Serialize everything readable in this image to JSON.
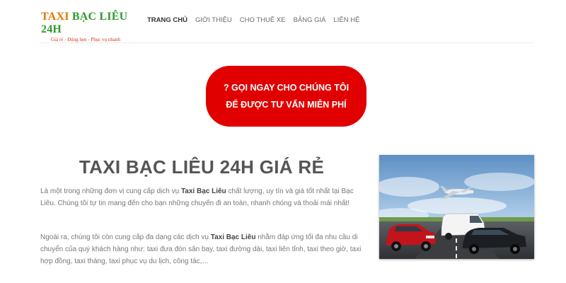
{
  "logo": {
    "title_part1": "TAXI ",
    "title_part2": "BẠC LIÊU 24H",
    "tagline": "Giá rẻ - Đúng hẹn - Phục vụ nhanh"
  },
  "nav": {
    "items": [
      {
        "label": "TRANG CHỦ",
        "active": true
      },
      {
        "label": "GIỚI THIỆU",
        "active": false
      },
      {
        "label": "CHO THUÊ XE",
        "active": false
      },
      {
        "label": "BẢNG GIÁ",
        "active": false
      },
      {
        "label": "LIÊN HỆ",
        "active": false
      }
    ]
  },
  "cta": {
    "line1": "? GỌI NGAY CHO CHÚNG TÔI",
    "line2": "ĐỂ ĐƯỢC TƯ VẤN MIỄN PHÍ"
  },
  "main": {
    "title": "TAXI BẠC LIÊU 24H GIÁ RẺ",
    "p1_pre": "Là một trong những đơn vị cung cấp dịch vụ ",
    "p1_bold": "Taxi Bạc Liêu",
    "p1_post": " chất lượng, uy tín và giá tốt nhất tại Bạc Liêu. Chúng tôi tự tin mang đến cho bạn những chuyến đi an toàn, nhanh chóng và thoải mái nhất!",
    "p2_pre": "Ngoài ra, chúng tôi còn cung cấp đa dạng các dịch vụ ",
    "p2_bold": "Taxi Bạc Liêu",
    "p2_post": " nhằm đáp ứng tối đa nhu cầu di chuyển của quý khách hàng như: taxi đưa đón sân bay, taxi đường dài, taxi liên tỉnh, taxi theo giờ, taxi hợp đồng, taxi tháng, taxi phục vụ du lịch, công tác,…"
  },
  "colors": {
    "cta_red": "#e10000",
    "logo_orange": "#e27700",
    "logo_green": "#2e9a2e"
  }
}
